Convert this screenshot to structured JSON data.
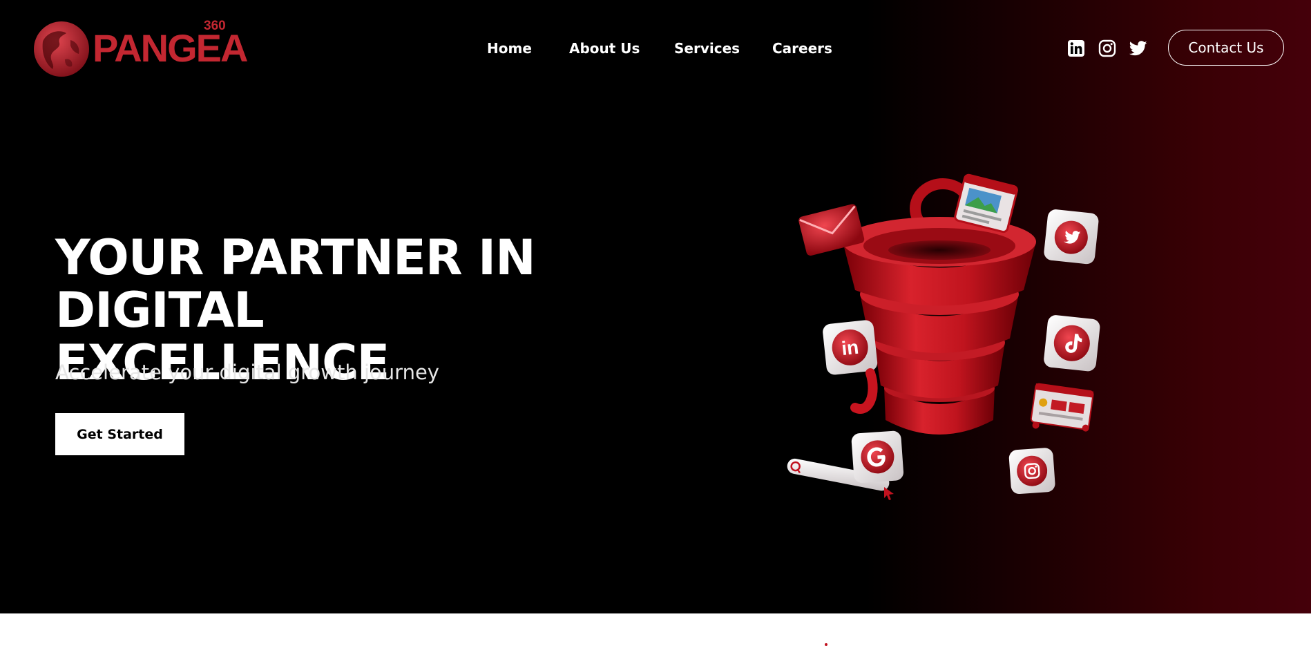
{
  "brand": {
    "name": "PANGEA",
    "number": "360",
    "color": "#c32731"
  },
  "nav": {
    "items": [
      {
        "label": "Home"
      },
      {
        "label": "About Us"
      },
      {
        "label": "Services"
      },
      {
        "label": "Careers"
      }
    ]
  },
  "social": {
    "icons": [
      "linkedin-icon",
      "instagram-icon",
      "twitter-icon"
    ]
  },
  "header": {
    "contact_label": "Contact Us"
  },
  "hero": {
    "headline_line1": "YOUR PARTNER IN",
    "headline_line2": "DIGITAL EXCELLENCE",
    "subheadline": "Accelerate your digital growth journey",
    "cta_label": "Get Started",
    "accent_color": "#c1121f",
    "illustration_icons": [
      "mail-icon",
      "image-icon",
      "twitter-icon",
      "linkedin-icon",
      "tiktok-icon",
      "browser-icon",
      "google-icon",
      "search-icon",
      "instagram-icon",
      "cursor-icon"
    ]
  }
}
